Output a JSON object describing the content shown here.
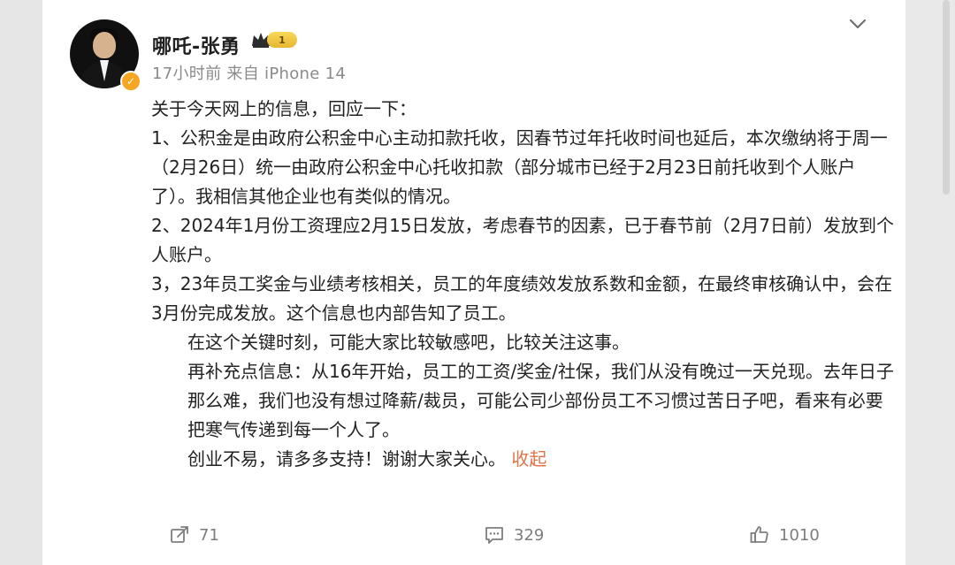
{
  "post": {
    "username": "哪吒-张勇",
    "level": "1",
    "meta": "17小时前  来自 iPhone 14",
    "content": [
      "关于今天网上的信息，回应一下：",
      "1、公积金是由政府公积金中心主动扣款托收，因春节过年托收时间也延后，本次缴纳将于周一（2月26日）统一由政府公积金中心托收扣款（部分城市已经于2月23日前托收到个人账户了）。我相信其他企业也有类似的情况。",
      "2、2024年1月份工资理应2月15日发放，考虑春节的因素，已于春节前（2月7日前）发放到个人账户。",
      "3，23年员工奖金与业绩考核相关，员工的年度绩效发放系数和金额，在最终审核确认中，会在3月份完成发放。这个信息也内部告知了员工。",
      "在这个关键时刻，可能大家比较敏感吧，比较关注这事。",
      "再补充点信息：从16年开始，员工的工资/奖金/社保，我们从没有晚过一天兑现。去年日子那么难，我们也没有想过降薪/裁员，可能公司少部份员工不习惯过苦日子吧，看来有必要把寒气传递到每一个人了。",
      "创业不易，请多多支持！谢谢大家关心。"
    ],
    "collapse_label": "收起"
  },
  "actions": {
    "share_count": "71",
    "comment_count": "329",
    "like_count": "1010"
  },
  "icons": {
    "header_dropdown": "chevron-down-icon",
    "share": "share-icon",
    "comment": "comment-icon",
    "like": "like-icon",
    "verified": "verified-badge-icon",
    "crown": "crown-icon"
  },
  "colors": {
    "link": "#e0744a",
    "meta": "#8a8a8a",
    "text": "#222222"
  }
}
